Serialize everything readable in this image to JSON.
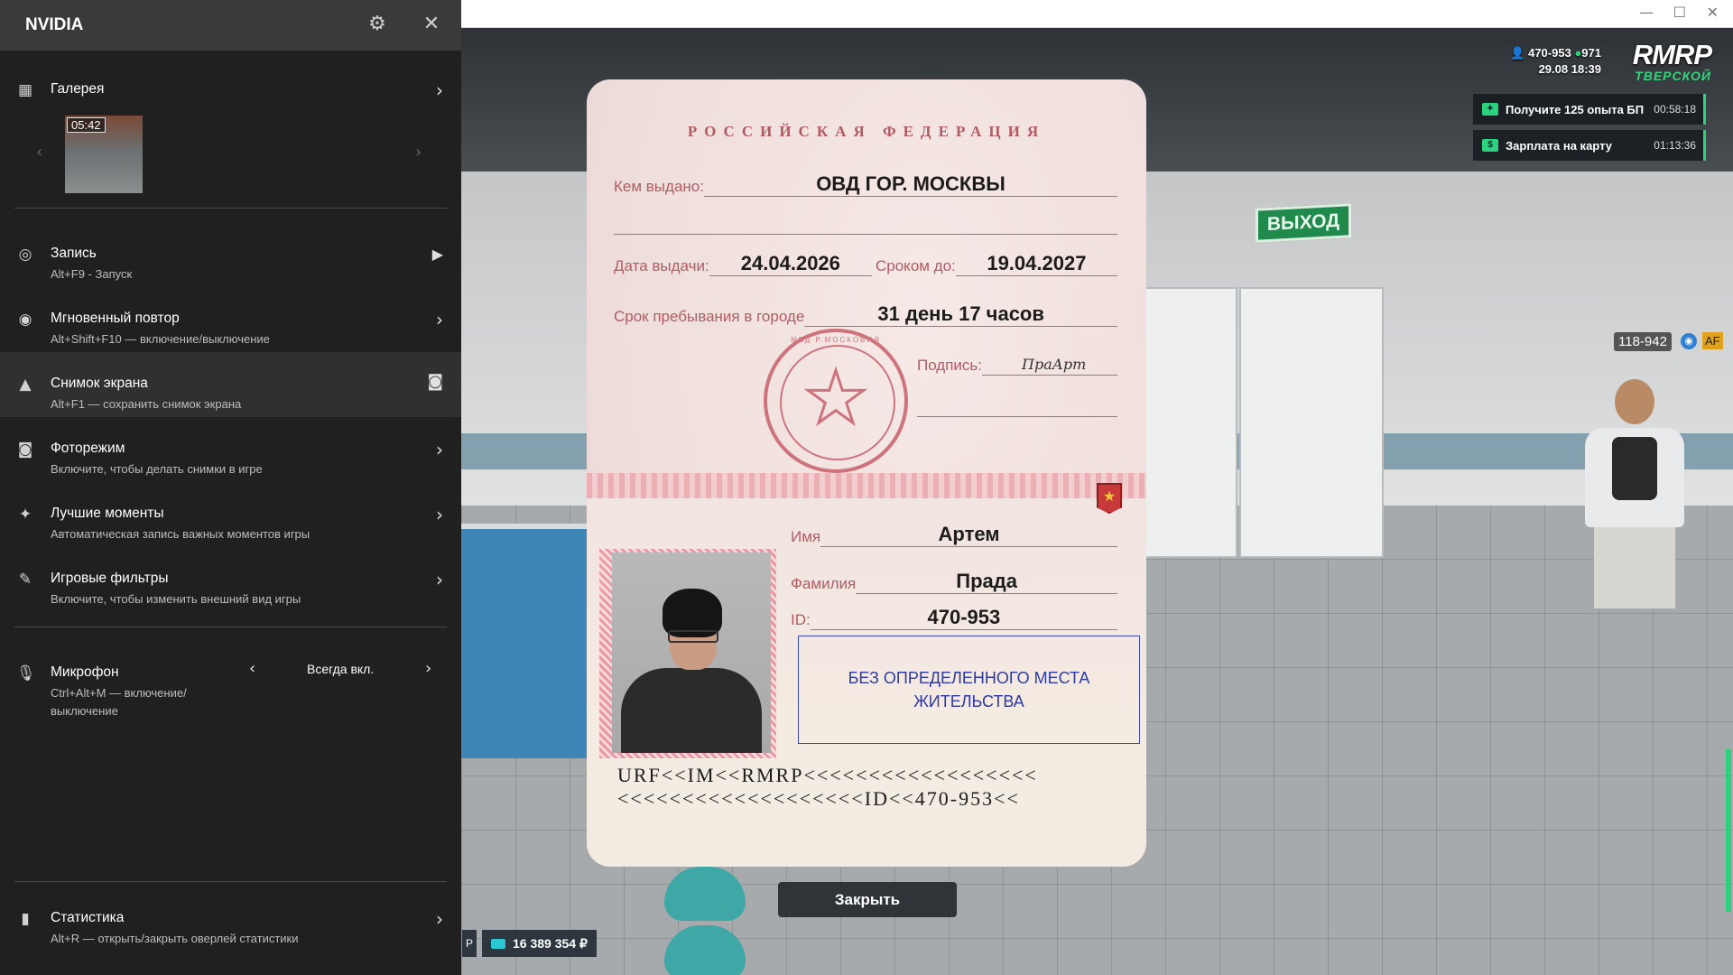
{
  "nvidia": {
    "title": "NVIDIA",
    "settings_icon": "gear-icon",
    "close_icon": "close-icon",
    "gallery": {
      "label": "Галерея",
      "thumb_time": "05:42"
    },
    "items": [
      {
        "label": "Запись",
        "sub": "Alt+F9 - Запуск",
        "icon": "record-icon"
      },
      {
        "label": "Мгновенный повтор",
        "sub": "Alt+Shift+F10 — включение/выключение",
        "icon": "replay-icon"
      },
      {
        "label": "Снимок экрана",
        "sub": "Alt+F1 — сохранить снимок экрана",
        "icon": "screenshot-icon"
      },
      {
        "label": "Фоторежим",
        "sub": "Включите, чтобы делать снимки в игре",
        "icon": "camera-icon"
      },
      {
        "label": "Лучшие моменты",
        "sub": "Автоматическая запись важных моментов игры",
        "icon": "highlights-icon"
      },
      {
        "label": "Игровые фильтры",
        "sub": "Включите, чтобы изменить внешний вид игры",
        "icon": "filter-icon"
      }
    ],
    "microphone": {
      "label": "Микрофон",
      "sub1": "Ctrl+Alt+M — включение/",
      "sub2": "выключение",
      "value": "Всегда вкл."
    },
    "statistics": {
      "label": "Статистика",
      "sub": "Alt+R — открыть/закрыть оверлей статистики"
    }
  },
  "hud": {
    "player_id": "470-953",
    "online": "971",
    "date": "29.08",
    "time": "18:39",
    "logo": "RMRP",
    "server": "ТВЕРСКОЙ",
    "quests": [
      {
        "text": "Получите 125 опыта БП",
        "timer": "00:58:18"
      },
      {
        "text": "Зарплата на карту",
        "timer": "01:13:36"
      }
    ],
    "nearby_player_tag": "118-942",
    "nearby_badge": "AF",
    "money": "16 389 354 ₽",
    "money_prefix": "Р"
  },
  "scene": {
    "exit_sign": "ВЫХОД"
  },
  "passport": {
    "header": "РОССИЙСКАЯ ФЕДЕРАЦИЯ",
    "issued_by_label": "Кем выдано:",
    "issued_by": "ОВД ГОР. МОСКВЫ",
    "issue_date_label": "Дата выдачи:",
    "issue_date": "24.04.2026",
    "valid_until_label": "Сроком до:",
    "valid_until": "19.04.2027",
    "city_stay_label": "Срок пребывания в городе",
    "city_stay": "31 день 17 часов",
    "signature_label": "Подпись:",
    "signature": "ПраАрт",
    "stamp_text": "МВД Р.МОСКОВИЯ",
    "first_name_label": "Имя",
    "first_name": "Артем",
    "last_name_label": "Фамилия",
    "last_name": "Прада",
    "id_label": "ID:",
    "id": "470-953",
    "residence": "БЕЗ ОПРЕДЕЛЕННОГО МЕСТА ЖИТЕЛЬСТВА",
    "mrz_line1": "URF<<IM<<RMRP<<<<<<<<<<<<<<<<<<",
    "mrz_line2": "<<<<<<<<<<<<<<<<<<<ID<<470-953<<"
  },
  "close_button": "Закрыть"
}
